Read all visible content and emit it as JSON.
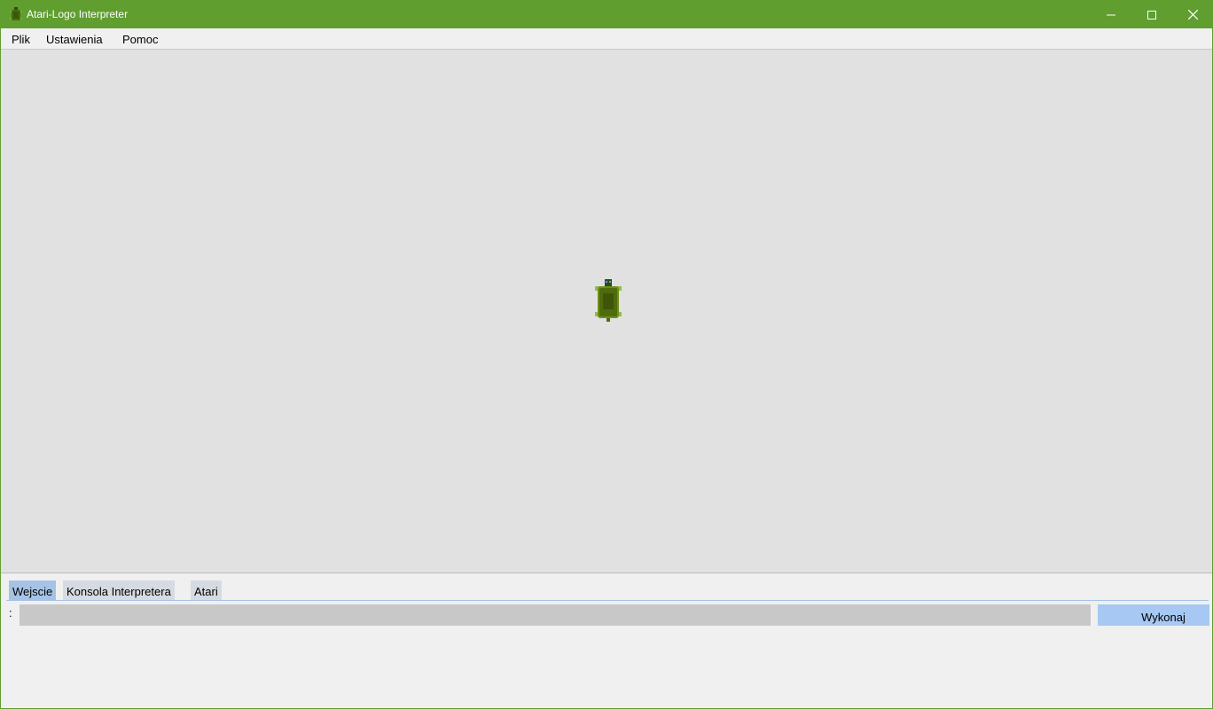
{
  "window": {
    "title": "Atari-Logo Interpreter",
    "accent_color": "#5f9e2f",
    "icon": "turtle-icon",
    "controls": [
      "minimize-icon",
      "maximize-icon",
      "close-icon"
    ]
  },
  "menu": {
    "file": "Plik",
    "settings": "Ustawienia",
    "help": "Pomoc"
  },
  "canvas": {
    "background": "#e1e1e1",
    "cursor_icon": "turtle-icon"
  },
  "bottom": {
    "tabs": [
      {
        "label": "Wejscie",
        "selected": true
      },
      {
        "label": "Konsola Interpretera",
        "selected": false
      },
      {
        "label": "Atari",
        "selected": false
      }
    ],
    "prompt": ":",
    "input": {
      "value": "",
      "placeholder": ""
    },
    "run_button": "Wykonaj",
    "run_button_color": "#a6c8f2",
    "active_tab_color": "#a6c3e6"
  }
}
